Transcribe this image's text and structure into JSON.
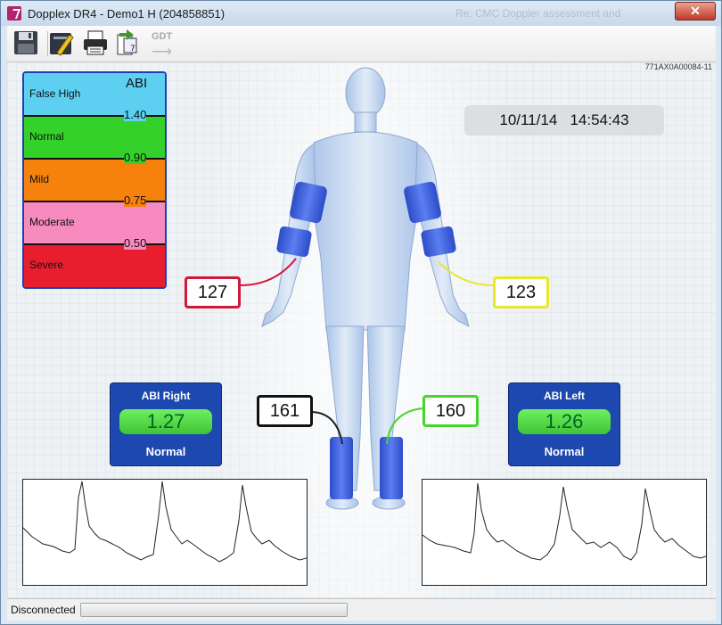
{
  "window": {
    "title": "Dopplex DR4 - Demo1 H (204858851)",
    "background_title": "Re: CMC Doppler assessment and",
    "close_label": "✕"
  },
  "toolbar": {
    "gdt_label": "GDT",
    "gdt_arrow": "⟶"
  },
  "device_id": "771AX0A00084-11",
  "abi_scale": {
    "title": "ABI",
    "bands": [
      {
        "label": "False High",
        "color": "#5dd0f2"
      },
      {
        "label": "Normal",
        "color": "#33d129"
      },
      {
        "label": "Mild",
        "color": "#f6820d"
      },
      {
        "label": "Moderate",
        "color": "#f78bbf"
      },
      {
        "label": "Severe",
        "color": "#e81e2e"
      }
    ],
    "thresholds": [
      "1.40",
      "0.90",
      "0.75",
      "0.50"
    ]
  },
  "datetime": {
    "date": "10/11/14",
    "time": "14:54:43"
  },
  "readings": {
    "right_arm": "127",
    "left_arm": "123",
    "right_ankle": "161",
    "left_ankle": "160"
  },
  "reading_colors": {
    "right_arm": "#d0183a",
    "left_arm": "#e8e82a",
    "right_ankle": "#111111",
    "left_ankle": "#44d62c"
  },
  "abi_right": {
    "title": "ABI Right",
    "value": "1.27",
    "classification": "Normal"
  },
  "abi_left": {
    "title": "ABI Left",
    "value": "1.26",
    "classification": "Normal"
  },
  "status": {
    "text": "Disconnected"
  }
}
